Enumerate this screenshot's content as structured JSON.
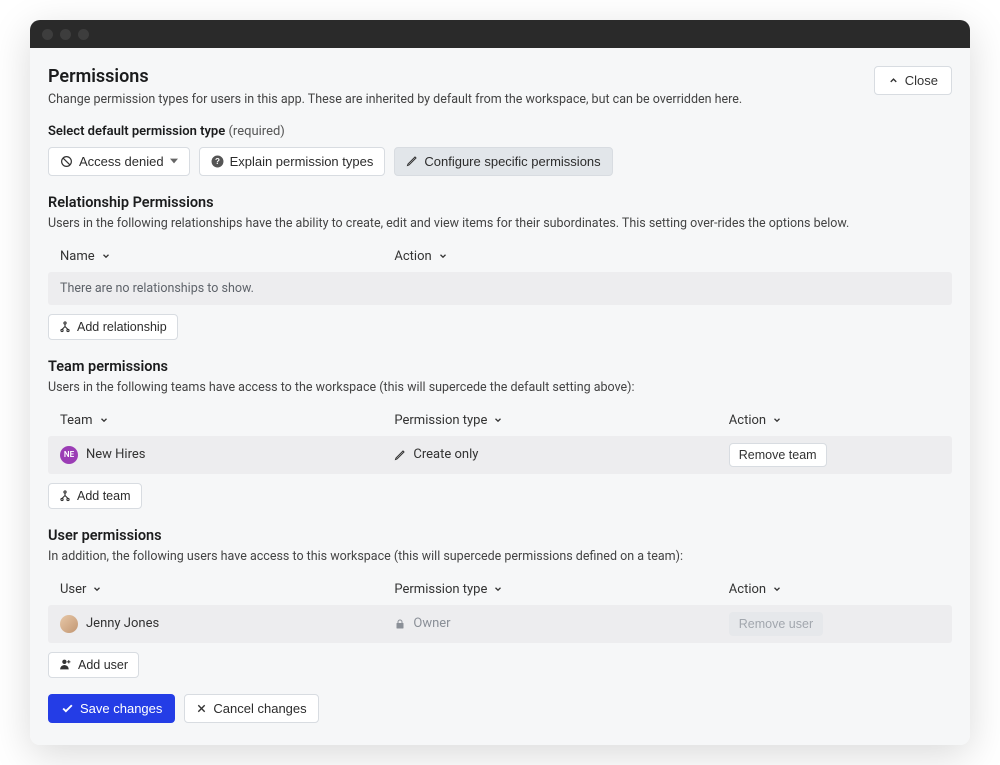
{
  "header": {
    "title": "Permissions",
    "subtitle": "Change permission types for users in this app. These are inherited by default from the workspace, but can be overridden here.",
    "close": "Close"
  },
  "default_perm": {
    "label": "Select default permission type",
    "required": "(required)",
    "access_denied": "Access denied",
    "explain": "Explain permission types",
    "configure": "Configure specific permissions"
  },
  "relationship": {
    "heading": "Relationship Permissions",
    "desc": "Users in the following relationships have the ability to create, edit and view items for their subordinates. This setting over-rides the options below.",
    "col_name": "Name",
    "col_action": "Action",
    "empty": "There are no relationships to show.",
    "add": "Add relationship"
  },
  "team": {
    "heading": "Team permissions",
    "desc": "Users in the following teams have access to the workspace (this will supercede the default setting above):",
    "col_team": "Team",
    "col_perm": "Permission type",
    "col_action": "Action",
    "row": {
      "name": "New Hires",
      "initials": "NE",
      "permission": "Create only",
      "remove": "Remove team"
    },
    "add": "Add team"
  },
  "user": {
    "heading": "User permissions",
    "desc": "In addition, the following users have access to this workspace (this will supercede permissions defined on a team):",
    "col_user": "User",
    "col_perm": "Permission type",
    "col_action": "Action",
    "row": {
      "name": "Jenny Jones",
      "permission": "Owner",
      "remove": "Remove user"
    },
    "add": "Add user"
  },
  "footer": {
    "save": "Save changes",
    "cancel": "Cancel changes"
  }
}
